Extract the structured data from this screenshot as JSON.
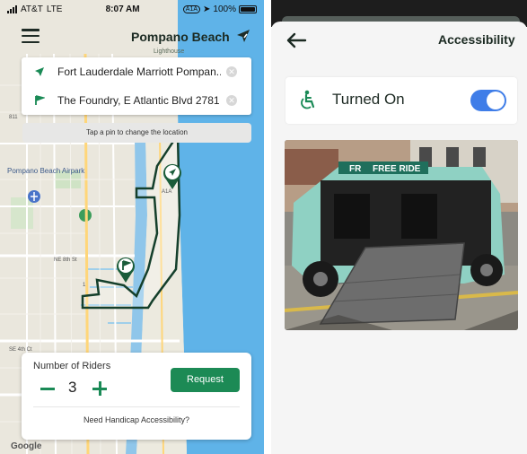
{
  "status_bar": {
    "carrier": "AT&T",
    "network": "LTE",
    "time": "8:07 AM",
    "route_badge": "A1A",
    "battery": "100%"
  },
  "map_screen": {
    "title": "Pompano Beach",
    "landmark": "Lighthouse",
    "origin": "Fort Lauderdale Marriott Pompan...",
    "destination": "The Foundry, E Atlantic Blvd 2781",
    "pin_hint": "Tap a pin to change the location",
    "map_labels": {
      "airport": "Pompano Beach Airpark",
      "road_a1a": "A1A",
      "road_811": "811",
      "road_1": "1",
      "ne_8th": "NE 8th St",
      "se_4th": "SE 4th Ct"
    },
    "riders": {
      "label": "Number of Riders",
      "count": "3",
      "request_label": "Request",
      "handicap_link": "Need Handicap Accessibility?"
    },
    "attribution": "Google",
    "colors": {
      "route_green": "#1a5c3a",
      "button_green": "#1c8a55",
      "water": "#5fb3e8",
      "land": "#eae7dd"
    }
  },
  "accessibility_screen": {
    "title": "Accessibility",
    "toggle_label": "Turned On",
    "toggle_state": true,
    "photo_text": "FREE RIDE",
    "photo_brand": "FR",
    "colors": {
      "switch_blue": "#3f7de8",
      "icon_green": "#1a8a56"
    }
  }
}
